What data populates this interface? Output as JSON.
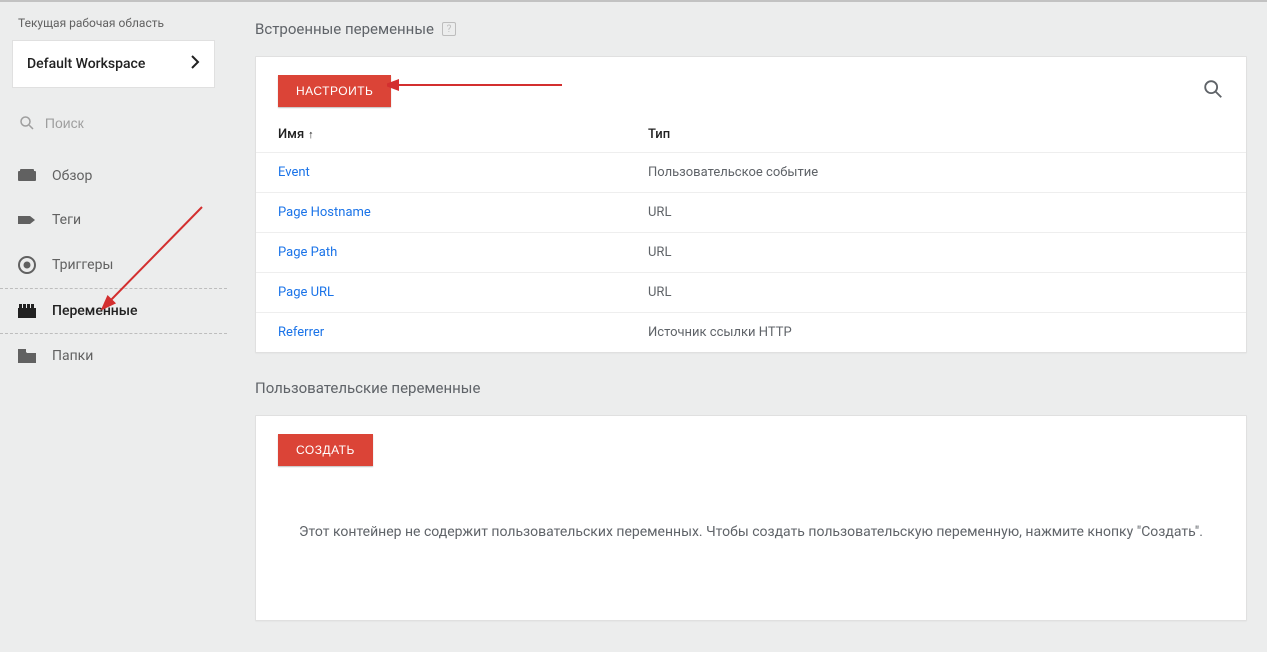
{
  "sidebar": {
    "workspace_label": "Текущая рабочая область",
    "workspace_name": "Default Workspace",
    "search_placeholder": "Поиск",
    "nav": [
      {
        "id": "overview",
        "label": "Обзор",
        "active": false
      },
      {
        "id": "tags",
        "label": "Теги",
        "active": false
      },
      {
        "id": "triggers",
        "label": "Триггеры",
        "active": false
      },
      {
        "id": "variables",
        "label": "Переменные",
        "active": true
      },
      {
        "id": "folders",
        "label": "Папки",
        "active": false
      }
    ]
  },
  "builtin": {
    "heading": "Встроенные переменные",
    "help": "?",
    "configure_button": "НАСТРОИТЬ",
    "col_name": "Имя",
    "col_type": "Тип",
    "sort_indicator": "↑",
    "rows": [
      {
        "name": "Event",
        "type": "Пользовательское событие"
      },
      {
        "name": "Page Hostname",
        "type": "URL"
      },
      {
        "name": "Page Path",
        "type": "URL"
      },
      {
        "name": "Page URL",
        "type": "URL"
      },
      {
        "name": "Referrer",
        "type": "Источник ссылки HTTP"
      }
    ]
  },
  "custom": {
    "heading": "Пользовательские переменные",
    "create_button": "СОЗДАТЬ",
    "empty_message": "Этот контейнер не содержит пользовательских переменных. Чтобы создать пользовательскую переменную, нажмите кнопку \"Создать\"."
  }
}
